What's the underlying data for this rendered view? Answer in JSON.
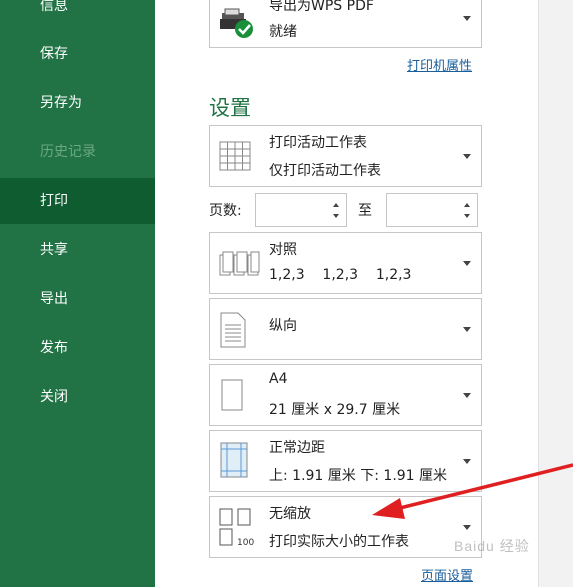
{
  "sidebar": {
    "items": [
      {
        "label": "信息"
      },
      {
        "label": "保存"
      },
      {
        "label": "另存为"
      },
      {
        "label": "历史记录"
      },
      {
        "label": "打印"
      },
      {
        "label": "共享"
      },
      {
        "label": "导出"
      },
      {
        "label": "发布"
      },
      {
        "label": "关闭"
      }
    ]
  },
  "printer": {
    "name": "导出为WPS PDF",
    "status": "就绪",
    "properties_link": "打印机属性"
  },
  "settings": {
    "heading": "设置",
    "what_to_print": {
      "title": "打印活动工作表",
      "subtitle": "仅打印活动工作表"
    },
    "pages": {
      "label": "页数:",
      "to_label": "至",
      "from_value": "",
      "to_value": ""
    },
    "collation": {
      "title": "对照",
      "subtitle": "1,2,3    1,2,3    1,2,3"
    },
    "orientation": {
      "title": "纵向"
    },
    "paper": {
      "title": "A4",
      "subtitle": "21 厘米 x 29.7 厘米"
    },
    "margins": {
      "title": "正常边距",
      "subtitle": "上: 1.91 厘米 下: 1.91 厘米"
    },
    "scaling": {
      "title": "无缩放",
      "subtitle": "打印实际大小的工作表",
      "icon_number": "100"
    },
    "page_setup_link": "页面设置"
  },
  "watermark": "Baidu 经验",
  "colors": {
    "sidebar": "#217346",
    "active": "#0e5c2f",
    "accent": "#217346",
    "arrow": "#e02020"
  }
}
